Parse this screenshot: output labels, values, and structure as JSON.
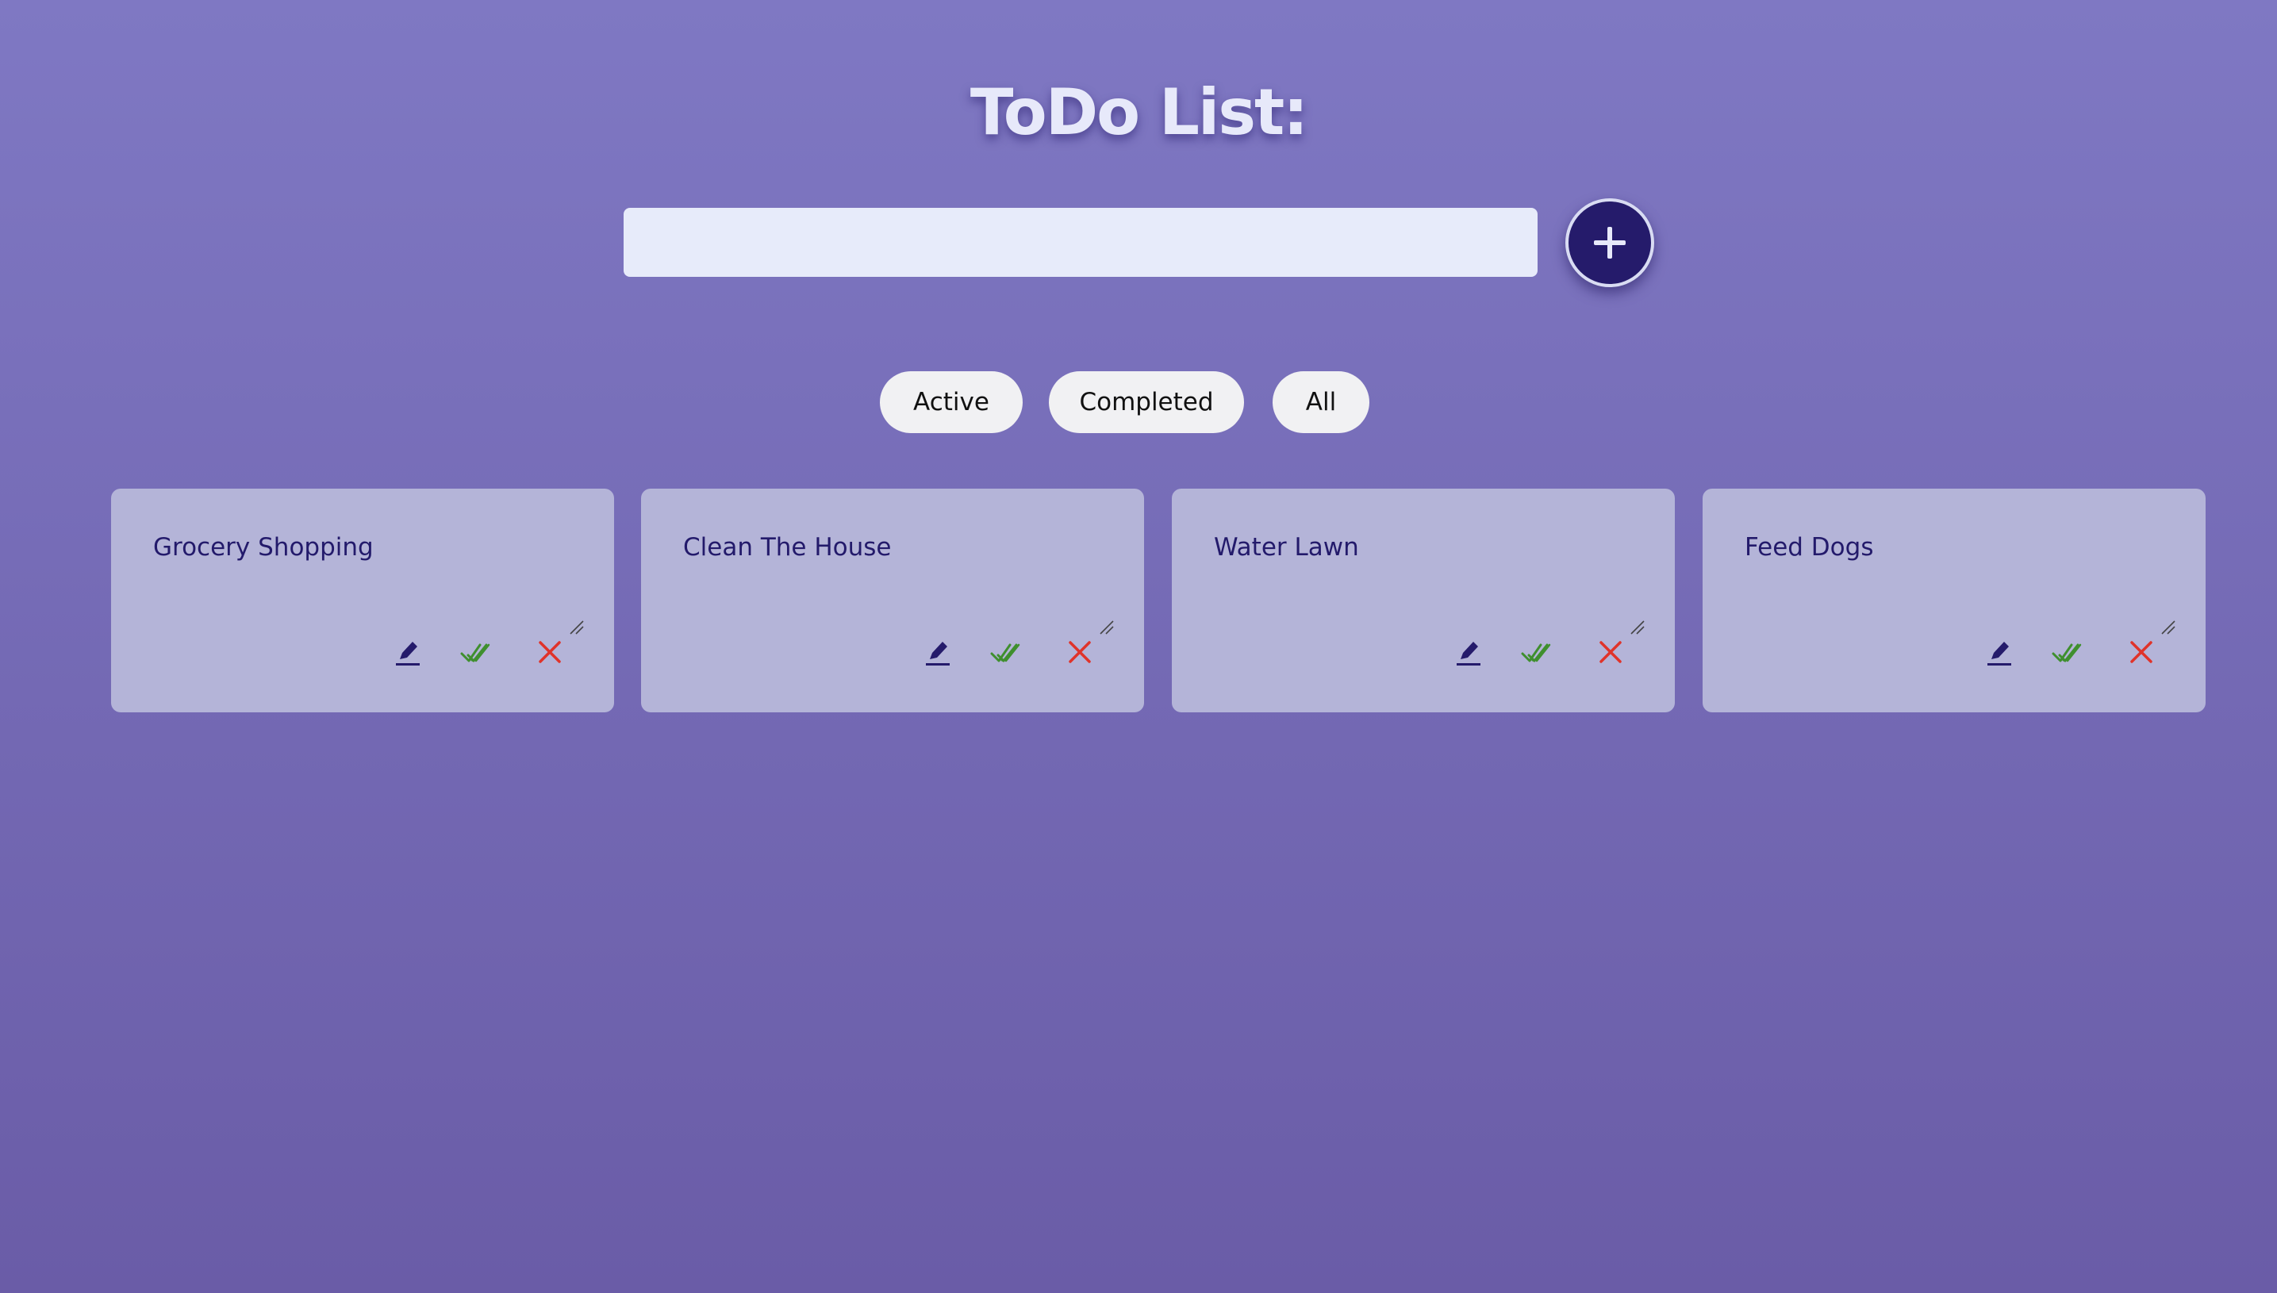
{
  "header": {
    "title": "ToDo List:"
  },
  "new_todo": {
    "value": "",
    "placeholder": ""
  },
  "add_button": {
    "icon": "plus-icon"
  },
  "filters": [
    {
      "label": "Active"
    },
    {
      "label": "Completed"
    },
    {
      "label": "All"
    }
  ],
  "todos": [
    {
      "title": "Grocery Shopping"
    },
    {
      "title": "Clean The House"
    },
    {
      "title": "Water Lawn"
    },
    {
      "title": "Feed Dogs"
    }
  ],
  "card_actions": {
    "edit_icon": "pencil-icon",
    "complete_icon": "double-check-icon",
    "delete_icon": "close-icon"
  },
  "colors": {
    "background_top": "#7f78c3",
    "background_bottom": "#6a5ca7",
    "accent_dark": "#251b6b",
    "card_bg": "#b4b4d8",
    "check_green": "#3f8f2e",
    "delete_red": "#e0332a"
  }
}
